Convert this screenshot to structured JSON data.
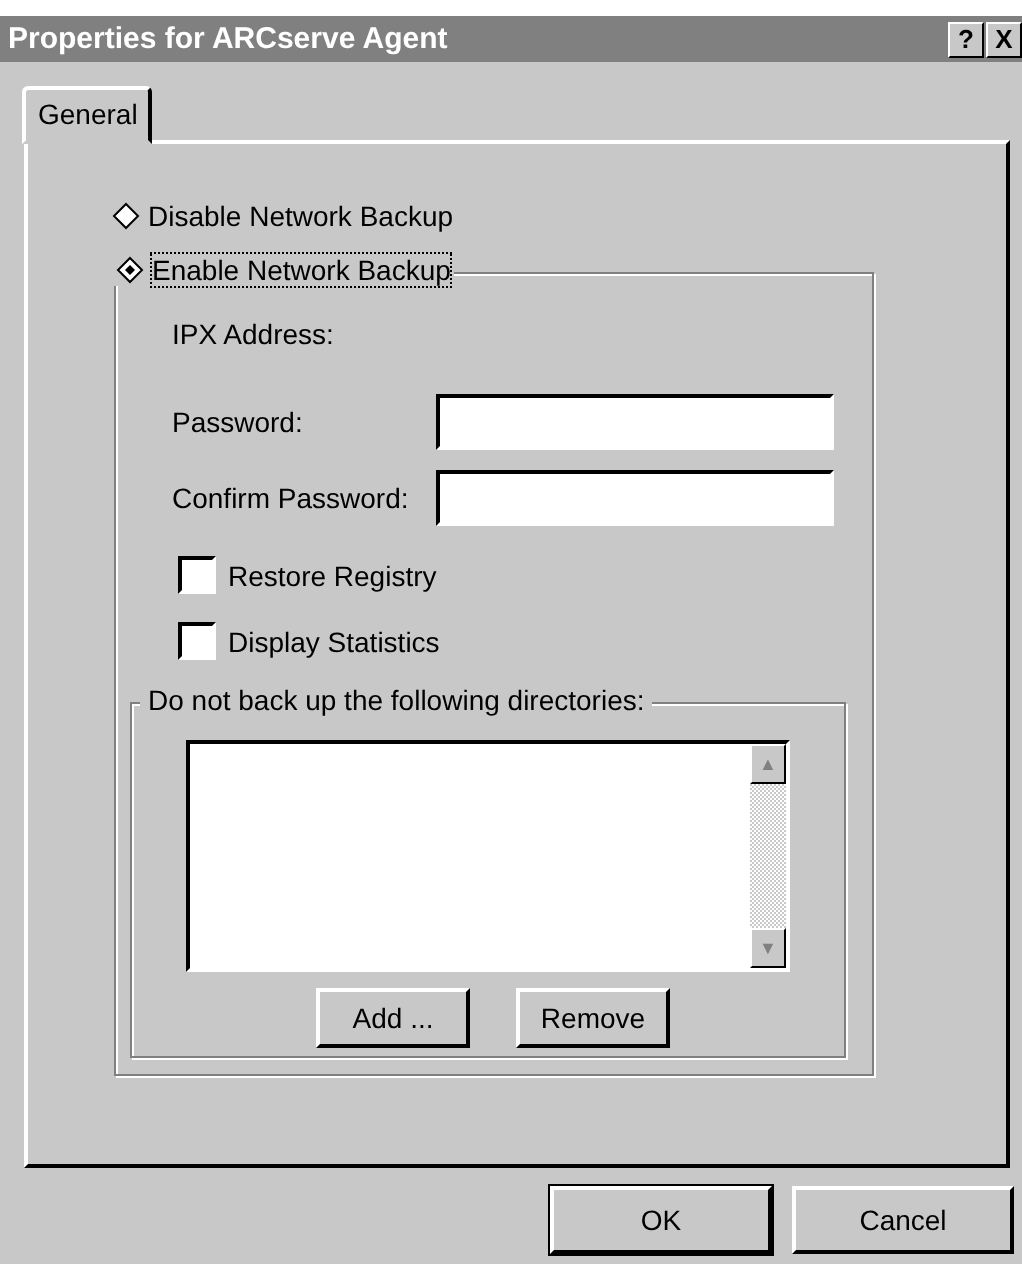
{
  "window": {
    "title": "Properties for ARCserve Agent",
    "title_buttons": [
      "?",
      "X"
    ]
  },
  "tabs": [
    {
      "label": "General",
      "selected": true
    }
  ],
  "radios": [
    {
      "label": "Disable Network Backup",
      "selected": false,
      "focused": false
    },
    {
      "label": "Enable Network Backup",
      "selected": true,
      "focused": true
    }
  ],
  "ipx_label": "IPX Address:",
  "fields": [
    {
      "label": "Password:"
    },
    {
      "label": "Confirm Password:"
    }
  ],
  "checkboxes": [
    {
      "label": "Restore Registry",
      "checked": false
    },
    {
      "label": "Display Statistics",
      "checked": false
    }
  ],
  "directories": {
    "title": "Do not back up the following directories:",
    "scroll_up": "▲",
    "scroll_down": "▼",
    "buttons": [
      "Add ...",
      "Remove"
    ]
  },
  "buttons": [
    {
      "label": "OK",
      "default": true
    },
    {
      "label": "Cancel",
      "default": false
    }
  ]
}
